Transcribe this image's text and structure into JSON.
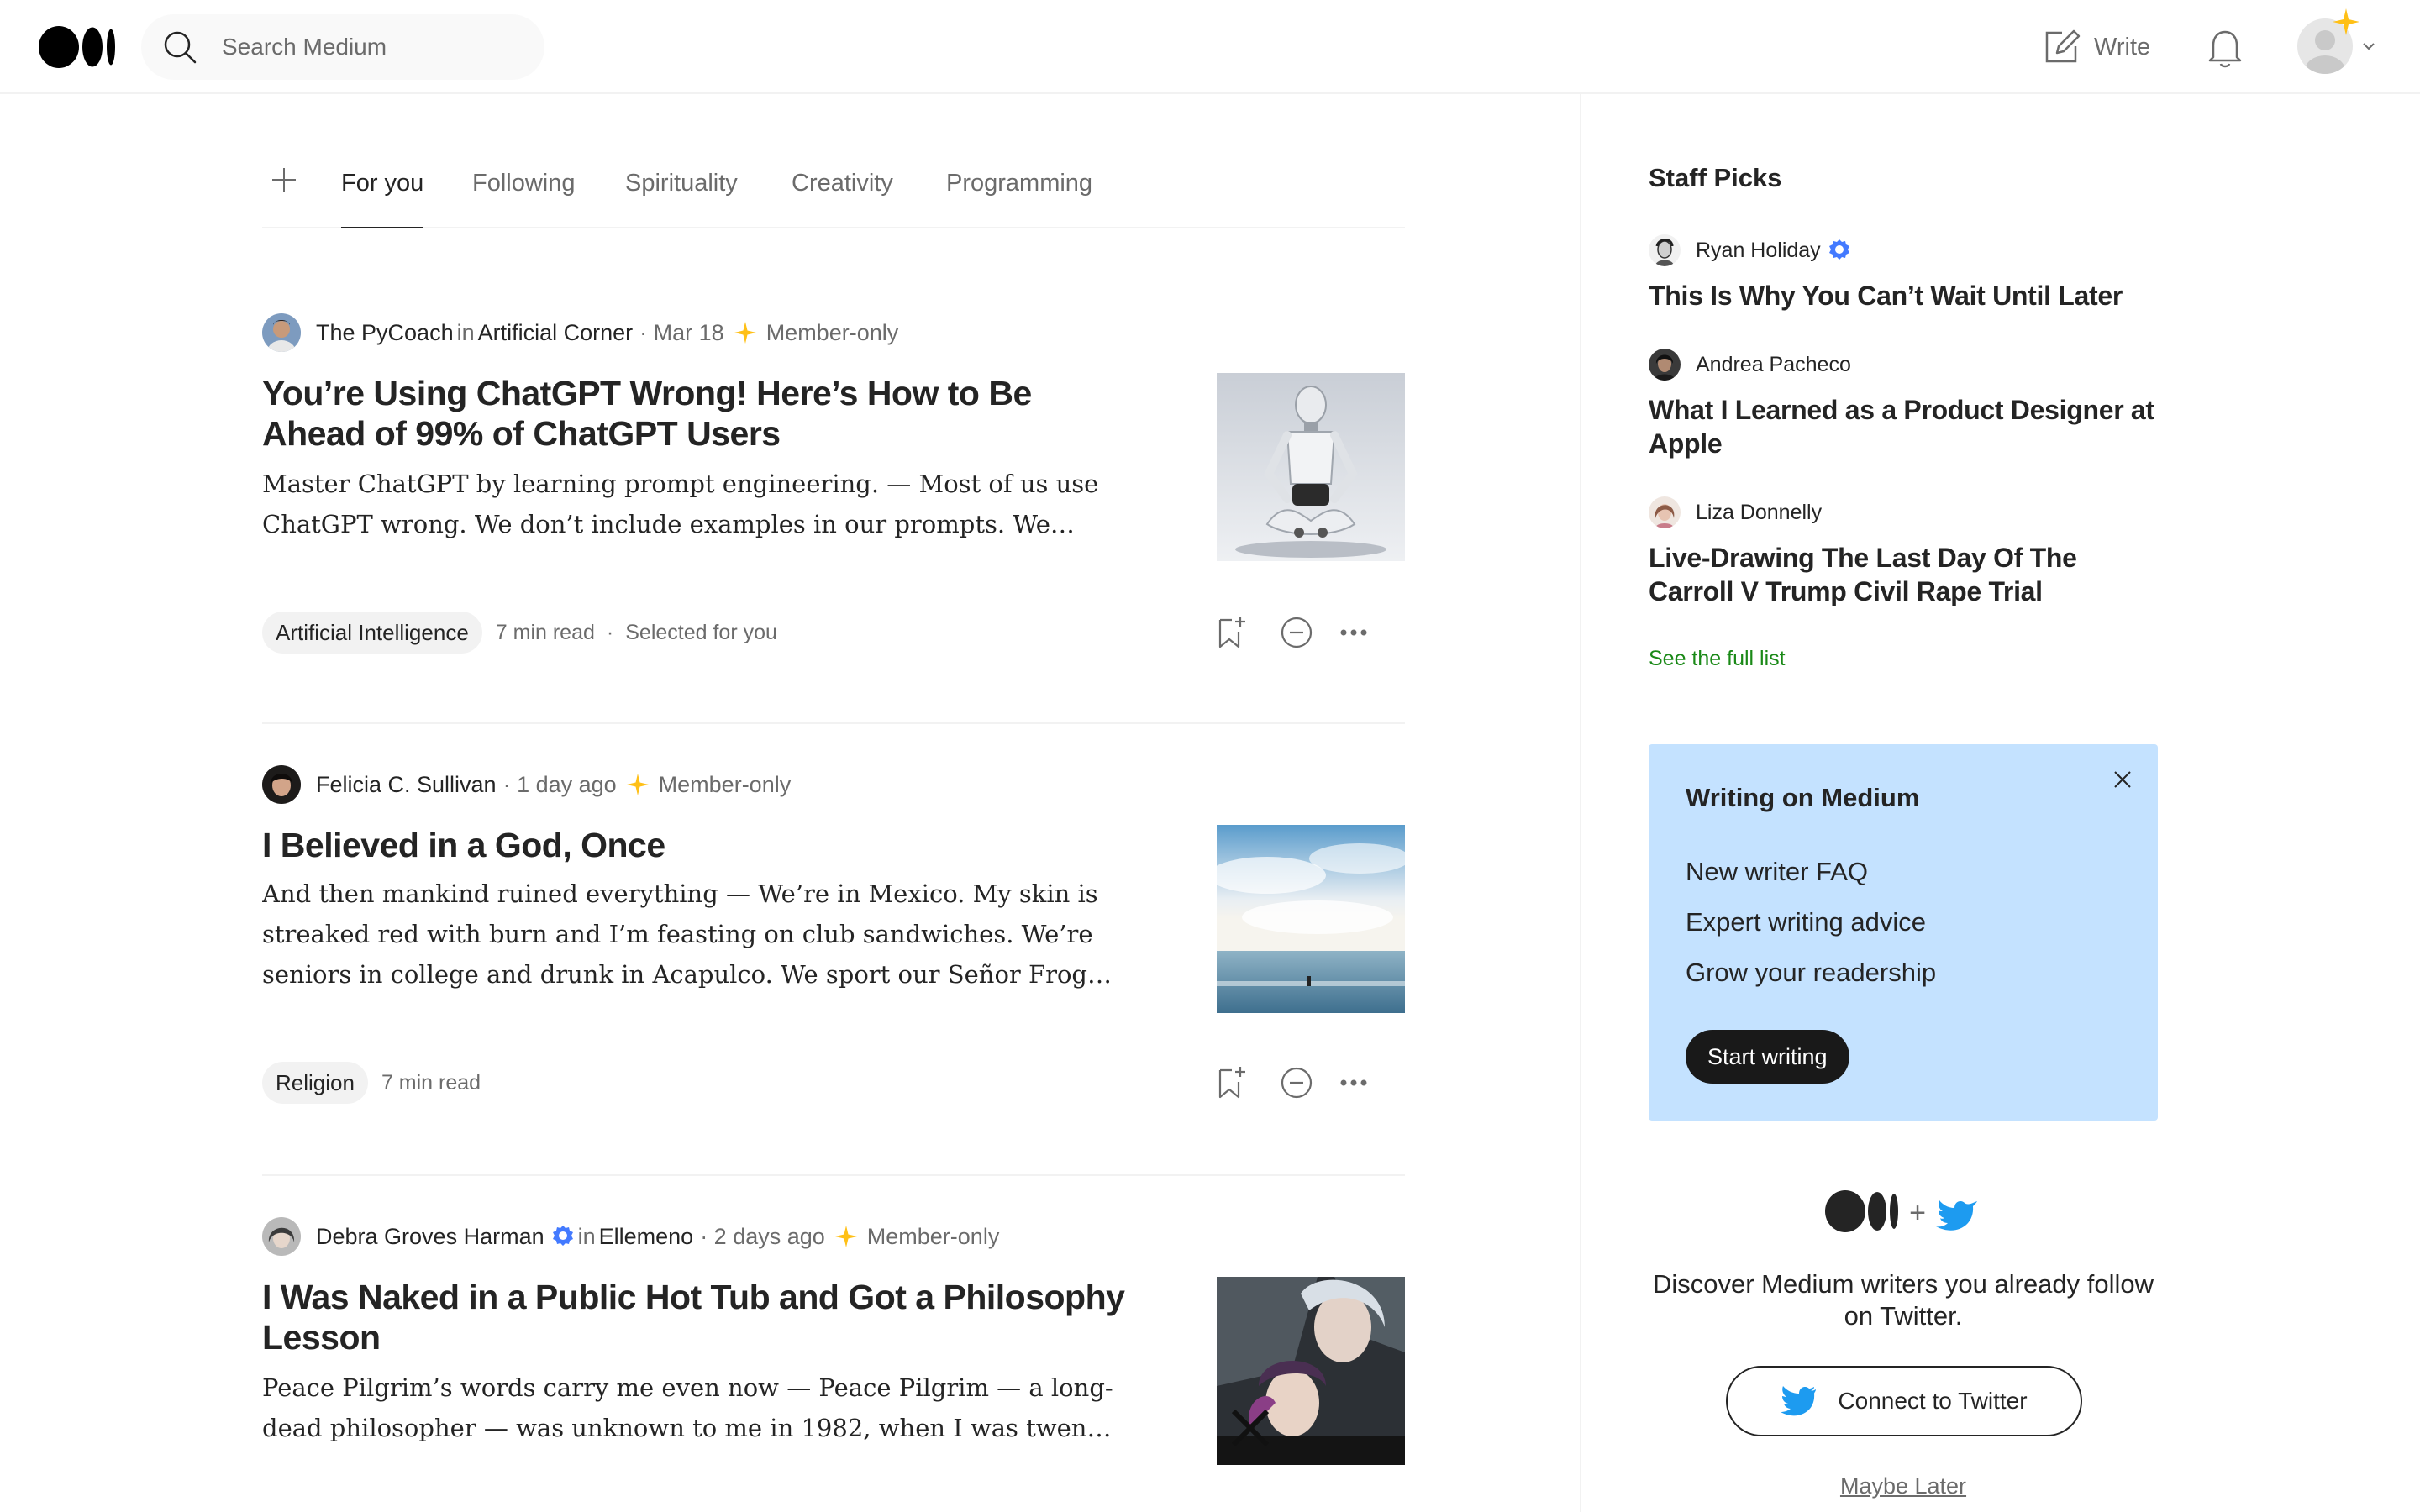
{
  "header": {
    "search_placeholder": "Search Medium",
    "write_label": "Write"
  },
  "tabs": [
    {
      "label": "For you",
      "active": true
    },
    {
      "label": "Following",
      "active": false
    },
    {
      "label": "Spirituality",
      "active": false
    },
    {
      "label": "Creativity",
      "active": false
    },
    {
      "label": "Programming",
      "active": false
    }
  ],
  "articles": [
    {
      "author": "The PyCoach",
      "in_word": "in",
      "publication": "Artificial Corner",
      "date": "· Mar 18",
      "member": "Member-only",
      "title": "You’re Using ChatGPT Wrong! Here’s How to Be Ahead of 99% of ChatGPT Users",
      "excerpt": "Master ChatGPT by learning prompt engineering. — Most of us use ChatGPT wrong. We don’t include examples in our prompts. We ignore that we can control ChatGPT’s behavior with roles.",
      "tag": "Artificial Intelligence",
      "read_time": "7 min read",
      "dot": "·",
      "extra": "Selected for you"
    },
    {
      "author": "Felicia C. Sullivan",
      "date": "· 1 day ago",
      "member": "Member-only",
      "title": "I Believed in a God, Once",
      "excerpt": "And then mankind ruined everything — We’re in Mexico. My skin is streaked red with burn and I’m feasting on club sandwiches. We’re seniors in college and drunk in Acapulco. We sport our Señor Frogs t-shirts.",
      "tag": "Religion",
      "read_time": "7 min read"
    },
    {
      "author": "Debra Groves Harman",
      "in_word": "in",
      "publication": "Ellemeno",
      "date": "· 2 days ago",
      "member": "Member-only",
      "title": "I Was Naked in a Public Hot Tub and Got a Philosophy Lesson",
      "excerpt": "Peace Pilgrim’s words carry me even now — Peace Pilgrim — a long-dead philosopher — was unknown to me in 1982, when I was twenty-two."
    }
  ],
  "sidebar": {
    "staff_picks_title": "Staff Picks",
    "picks": [
      {
        "author": "Ryan Holiday",
        "title": "This Is Why You Can’t Wait Until Later"
      },
      {
        "author": "Andrea Pacheco",
        "title": "What I Learned as a Product Designer at Apple"
      },
      {
        "author": "Liza Donnelly",
        "title": "Live-Drawing The Last Day Of The Carroll V Trump Civil Rape Trial"
      }
    ],
    "see_full_list": "See the full list",
    "writing_box": {
      "title": "Writing on Medium",
      "links": [
        "New writer FAQ",
        "Expert writing advice",
        "Grow your readership"
      ],
      "button": "Start writing"
    },
    "twitter": {
      "plus": "+",
      "text": "Discover Medium writers you already follow on Twitter.",
      "button": "Connect to Twitter",
      "later": "Maybe Later"
    }
  },
  "colors": {
    "accent_green": "#1a8917",
    "member_star": "#ffc017",
    "writing_box_bg": "#c4e2ff",
    "twitter_blue": "#1d9bf0",
    "verified_blue": "#437aff"
  }
}
